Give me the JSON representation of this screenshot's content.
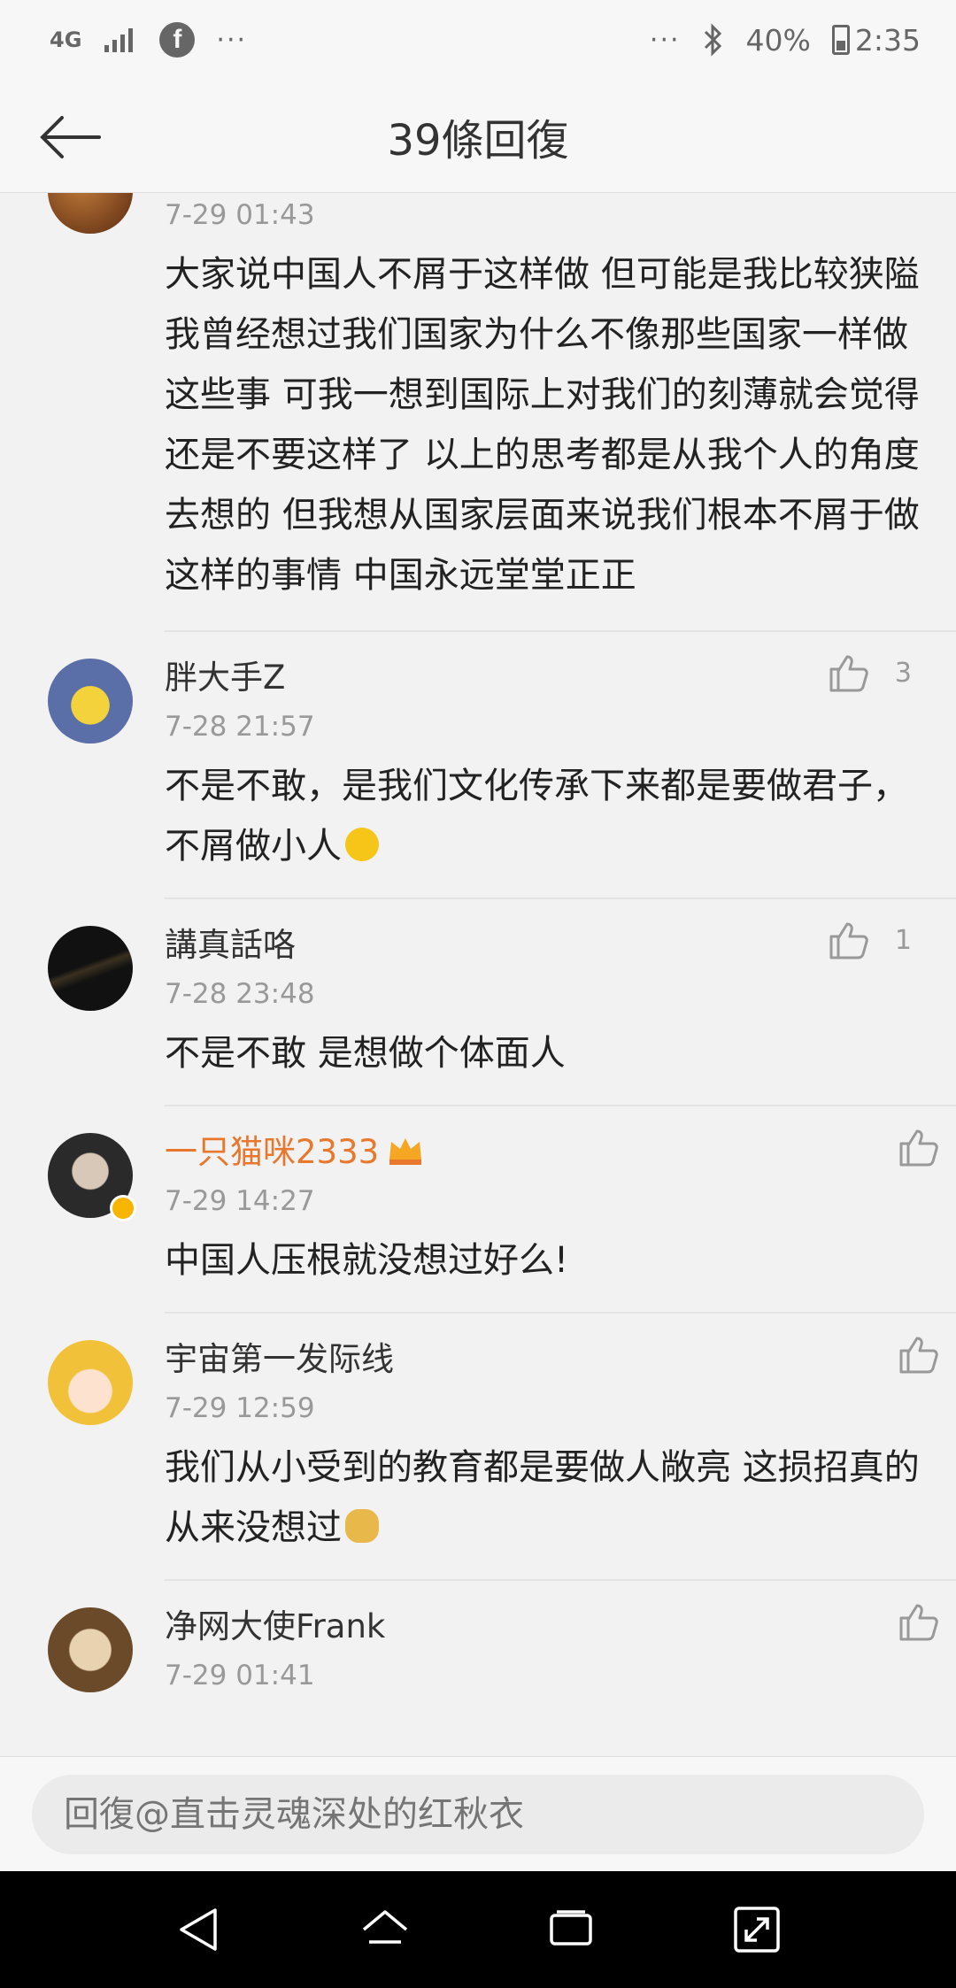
{
  "status_bar": {
    "network": "4G",
    "facebook": "f",
    "more_left": "···",
    "more_right": "···",
    "battery": "40%",
    "time": "2:35"
  },
  "header": {
    "title": "39條回復"
  },
  "comments": [
    {
      "username": "",
      "time": "7-29 01:43",
      "text": "大家说中国人不屑于这样做 但可能是我比较狭隘 我曾经想过我们国家为什么不像那些国家一样做这些事 可我一想到国际上对我们的刻薄就会觉得还是不要这样了 以上的思考都是从我个人的角度去想的 但我想从国家层面来说我们根本不屑于做这样的事情 中国永远堂堂正正",
      "likes": ""
    },
    {
      "username": "胖大手Z",
      "time": "7-28 21:57",
      "text": "不是不敢，是我们文化传承下来都是要做君子，不屑做小人",
      "likes": "3"
    },
    {
      "username": "講真話咯",
      "time": "7-28 23:48",
      "text": "不是不敢 是想做个体面人",
      "likes": "1"
    },
    {
      "username": "一只猫咪2333",
      "time": "7-29 14:27",
      "text": "中国人压根就没想过好么!",
      "likes": ""
    },
    {
      "username": "宇宙第一发际线",
      "time": "7-29 12:59",
      "text": "我们从小受到的教育都是要做人敞亮 这损招真的从来没想过",
      "likes": ""
    },
    {
      "username": "净网大使Frank",
      "time": "7-29 01:41",
      "text": "",
      "likes": ""
    }
  ],
  "reply": {
    "placeholder": "回復@直击灵魂深处的红秋衣"
  },
  "colors": {
    "vip_name": "#e8782d",
    "meta": "#999999"
  }
}
